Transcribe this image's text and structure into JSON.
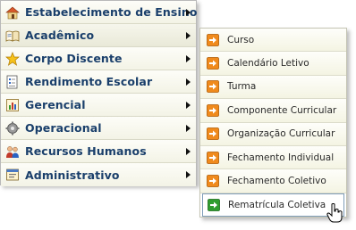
{
  "main_menu": {
    "items": [
      {
        "label": "Estabelecimento de Ensino",
        "icon": "school-house-icon"
      },
      {
        "label": "Acadêmico",
        "icon": "open-book-icon"
      },
      {
        "label": "Corpo Discente",
        "icon": "star-icon"
      },
      {
        "label": "Rendimento Escolar",
        "icon": "report-card-icon"
      },
      {
        "label": "Gerencial",
        "icon": "chart-icon"
      },
      {
        "label": "Operacional",
        "icon": "gear-icon"
      },
      {
        "label": "Recursos Humanos",
        "icon": "people-icon"
      },
      {
        "label": "Administrativo",
        "icon": "window-folder-icon"
      }
    ],
    "active_index": 1
  },
  "submenu": {
    "items": [
      {
        "label": "Curso"
      },
      {
        "label": "Calendário Letivo"
      },
      {
        "label": "Turma"
      },
      {
        "label": "Componente Curricular"
      },
      {
        "label": "Organização Curricular"
      },
      {
        "label": "Fechamento Individual"
      },
      {
        "label": "Fechamento Coletivo"
      },
      {
        "label": "Rematrícula Coletiva"
      }
    ],
    "hovered_index": 7
  },
  "colors": {
    "main_label": "#1a3f6b",
    "arrow_orange": "#f08a1c",
    "arrow_green": "#2f9d2f"
  }
}
